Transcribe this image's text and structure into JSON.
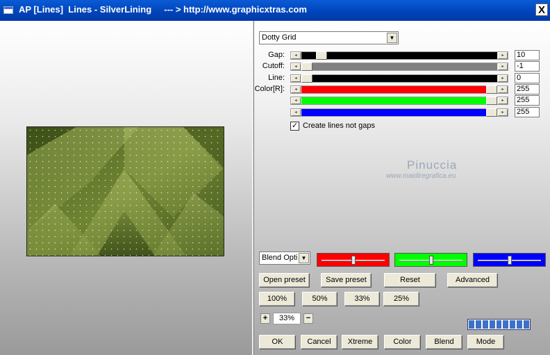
{
  "window": {
    "title": "AP [Lines]  Lines - SilverLining     --- > http://www.graphicxtras.com",
    "close_label": "X"
  },
  "preset_combo": {
    "value": "Dotty Grid"
  },
  "sliders": [
    {
      "label": "Gap:",
      "value": "10",
      "fill": "#000000",
      "thumb_pct": 8
    },
    {
      "label": "Cutoff:",
      "value": "-1",
      "fill": "#808080",
      "thumb_pct": 0
    },
    {
      "label": "Line:",
      "value": "0",
      "fill": "#000000",
      "thumb_pct": 0
    },
    {
      "label": "Color[R]:",
      "value": "255",
      "fill": "#ff0000",
      "thumb_pct": 100
    },
    {
      "label": "",
      "value": "255",
      "fill": "#00ff00",
      "thumb_pct": 100
    },
    {
      "label": "",
      "value": "255",
      "fill": "#0000ff",
      "thumb_pct": 100
    }
  ],
  "create_lines": {
    "label": "Create lines not gaps",
    "checked": true
  },
  "watermark": {
    "name": "Pinuccia",
    "url": "www.maidiregrafica.eu"
  },
  "blend_combo": {
    "value": "Blend Opti"
  },
  "color_boxes": [
    {
      "color": "#ff0000",
      "level": 0.5
    },
    {
      "color": "#00ff00",
      "level": 0.5
    },
    {
      "color": "#0000ff",
      "level": 0.5
    }
  ],
  "buttons": {
    "open_preset": "Open preset",
    "save_preset": "Save preset",
    "reset": "Reset",
    "advanced": "Advanced",
    "z100": "100%",
    "z50": "50%",
    "z33": "33%",
    "z25": "25%",
    "ok": "OK",
    "cancel": "Cancel",
    "xtreme": "Xtreme",
    "color": "Color",
    "blend": "Blend",
    "mode": "Mode"
  },
  "zoom": {
    "plus": "+",
    "value": "33%",
    "minus": "−"
  },
  "progress": {
    "segments": 9,
    "fraction": 1.0
  },
  "colors": {
    "title_bar": "#0048c0",
    "preview_dark": "#3f5418",
    "preview_light": "#b6c46c"
  }
}
